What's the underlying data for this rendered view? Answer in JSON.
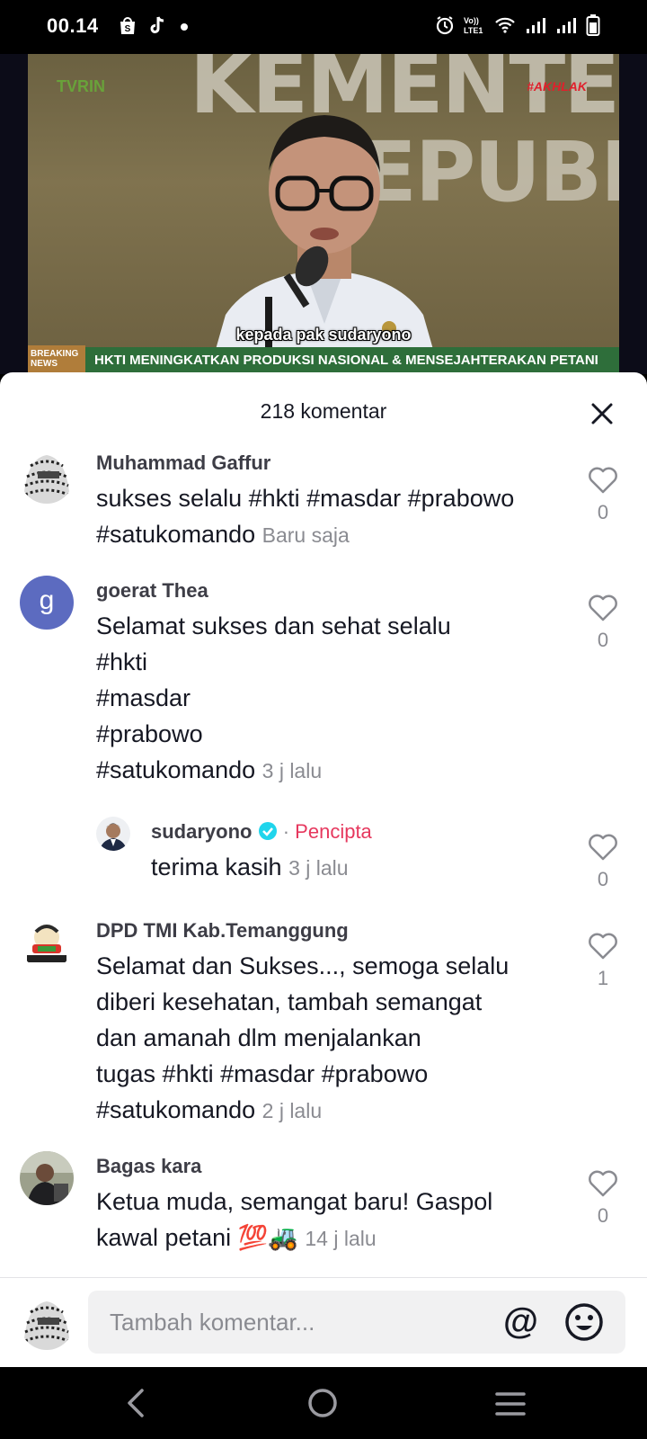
{
  "status_bar": {
    "time": "00.14",
    "icons": [
      "shopee-bag-icon",
      "tiktok-icon",
      "notification-dot-icon",
      "alarm-icon",
      "volte-lte1-icon",
      "wifi-icon",
      "signal-sim1-icon",
      "signal-sim2-icon",
      "battery-icon"
    ],
    "volte_label": "Vo)) LTE1"
  },
  "video": {
    "caption": "kepada pak sudaryono",
    "channel_logo": "TVRIN",
    "campaign_logo": "#AKHLAK",
    "breaking_badge": "BREAKING NEWS",
    "ticker": "HKTI MENINGKATKAN PRODUKSI NASIONAL & MENSEJAHTERAKAN PETANI",
    "wall_text_line1": "KEMENTE",
    "wall_text_line2": "EPUBL"
  },
  "comments_sheet": {
    "title": "218 komentar",
    "close_icon": "close-icon",
    "comments": [
      {
        "author": "Muhammad Gaffur",
        "text": "sukses selalu #hkti #masdar #prabowo\n#satukomando",
        "time": "Baru saja",
        "likes": "0"
      },
      {
        "author": "goerat Thea",
        "avatar_letter": "g",
        "text": "Selamat sukses dan sehat selalu\n#hkti\n#masdar\n#prabowo\n#satukomando",
        "time": "3 j lalu",
        "likes": "0"
      },
      {
        "author": "sudaryono",
        "creator_label": "Pencipta",
        "separator": "·",
        "text": "terima kasih",
        "time": "3 j lalu",
        "likes": "0",
        "is_reply": true
      },
      {
        "author": "DPD TMI Kab.Temanggung",
        "text": "Selamat dan Sukses..., semoga selalu\ndiberi kesehatan, tambah semangat\ndan amanah dlm menjalankan\ntugas #hkti #masdar #prabowo\n#satukomando",
        "time": "2 j lalu",
        "likes": "1"
      },
      {
        "author": "Bagas kara",
        "text": "Ketua muda, semangat baru! Gaspol\nkawal petani 💯🚜",
        "time": "14 j lalu",
        "likes": "0"
      }
    ]
  },
  "input_bar": {
    "placeholder": "Tambah komentar...",
    "mention_icon": "@",
    "emoji_icon": "emoji-icon"
  },
  "nav_bar": {
    "icons": [
      "back-icon",
      "home-icon",
      "recents-icon"
    ]
  },
  "colors": {
    "accent_creator": "#e6385e",
    "verified": "#20d5ec",
    "avatar_g": "#5c6bc0"
  }
}
